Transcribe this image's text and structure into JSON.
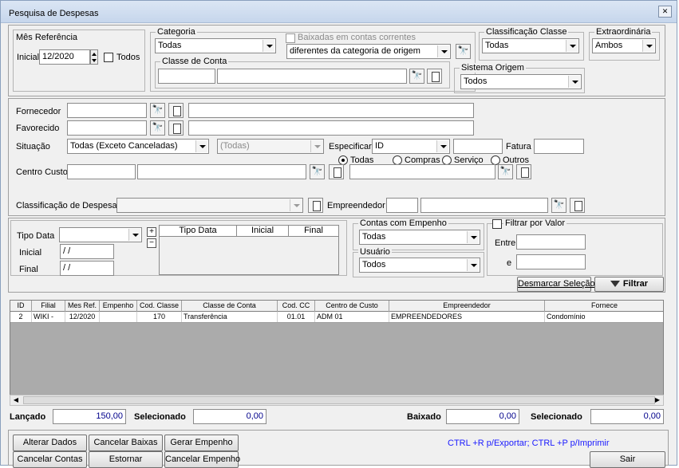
{
  "window": {
    "title": "Pesquisa de Despesas",
    "close_label": "✕"
  },
  "mes": {
    "legend": "Mês Referência",
    "inicial_label": "Inicial",
    "inicial_value": "12/2020",
    "todos_label": "Todos"
  },
  "categoria": {
    "legend": "Categoria",
    "value": "Todas"
  },
  "baixadas": {
    "legend": "Baixadas em contas correntes",
    "value": "diferentes da categoria de origem"
  },
  "classificacao_classe": {
    "legend": "Classificação Classe",
    "value": "Todas"
  },
  "extraordinaria": {
    "legend": "Extraordinária",
    "value": "Ambos"
  },
  "classe_conta": {
    "legend": "Classe de Conta"
  },
  "sistema_origem": {
    "legend": "Sistema Origem",
    "value": "Todos"
  },
  "form": {
    "fornecedor": "Fornecedor",
    "favorecido": "Favorecido",
    "situacao": "Situação",
    "situacao_value": "Todas (Exceto Canceladas)",
    "situacao2_value": "(Todas)",
    "especificar": "Especificar",
    "especificar_value": "ID",
    "fatura": "Fatura",
    "centro_custo": "Centro Custo",
    "radios": [
      "Todas",
      "Compras",
      "Serviço",
      "Outros"
    ],
    "classificacao_despesas": "Classificação de Despesas",
    "empreendedor": "Empreendedor"
  },
  "datas": {
    "tipo_data": "Tipo Data",
    "inicial": "Inicial",
    "final": "Final",
    "inicial_value": "/ /",
    "final_value": "/ /",
    "cols": [
      "Tipo Data",
      "Inicial",
      "Final"
    ],
    "plus": "+",
    "minus": "−"
  },
  "contas_empenho": {
    "legend": "Contas com Empenho",
    "value": "Todas"
  },
  "usuario": {
    "legend": "Usuário",
    "value": "Todos"
  },
  "filtrar_valor": {
    "label": "Filtrar por Valor",
    "entre": "Entre",
    "e": "e"
  },
  "buttons": {
    "desmarcar": "Desmarcar Seleção",
    "filtrar": "Filtrar"
  },
  "grid": {
    "columns": [
      "ID",
      "Filial",
      "Mes Ref.",
      "Empenho",
      "Cod. Classe",
      "Classe de Conta",
      "Cod. CC",
      "Centro de Custo",
      "Empreendedor",
      "Fornece"
    ],
    "rows": [
      [
        "2",
        "WIKI -",
        "12/2020",
        "",
        "170",
        "Transferência",
        "01.01",
        "ADM 01",
        "EMPREENDEDORES",
        "Condomínio"
      ]
    ]
  },
  "totals": {
    "lancado_label": "Lançado",
    "lancado_value": "150,00",
    "selecionado_label": "Selecionado",
    "selecionado_value": "0,00",
    "baixado_label": "Baixado",
    "baixado_value": "0,00",
    "selecionado2_label": "Selecionado",
    "selecionado2_value": "0,00"
  },
  "actions": {
    "alterar": "Alterar Dados",
    "cancelar_baixas": "Cancelar Baixas",
    "gerar_empenho": "Gerar Empenho",
    "cancelar_contas": "Cancelar Contas",
    "estornar": "Estornar",
    "cancelar_empenho": "Cancelar Empenho",
    "hint": "CTRL +R p/Exportar; CTRL +P p/Imprimir",
    "sair": "Sair"
  },
  "colors": {
    "hint": "#1a1aff",
    "value_text": "#00008b"
  }
}
